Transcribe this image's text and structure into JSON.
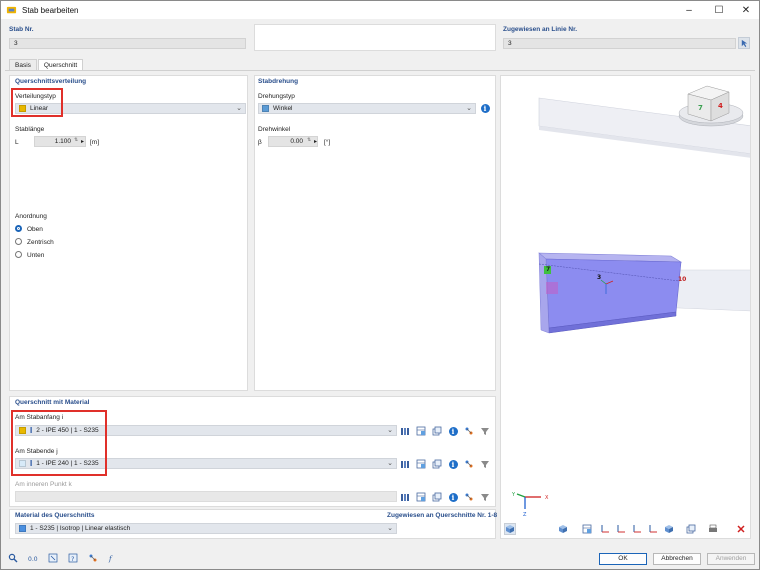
{
  "window": {
    "title": "Stab bearbeiten",
    "minimize": "–",
    "maximize": "☐",
    "close": "✕"
  },
  "header": {
    "member_no_label": "Stab Nr.",
    "member_no_value": "3",
    "line_label": "Zugewiesen an Linie Nr.",
    "line_value": "3"
  },
  "tabs": [
    {
      "label": "Basis"
    },
    {
      "label": "Querschnitt"
    }
  ],
  "distribution": {
    "section_title": "Querschnittsverteilung",
    "type_label": "Verteilungstyp",
    "type_value": "Linear",
    "type_color": "#e8b800",
    "length_label": "Stablänge",
    "length_symbol": "L",
    "length_value": "1.100",
    "length_unit": "[m]",
    "arrangement_label": "Anordnung",
    "options": [
      {
        "label": "Oben",
        "selected": true
      },
      {
        "label": "Zentrisch",
        "selected": false
      },
      {
        "label": "Unten",
        "selected": false
      }
    ]
  },
  "rotation": {
    "section_title": "Stabdrehung",
    "type_label": "Drehungstyp",
    "type_value": "Winkel",
    "type_color": "#5b9bd5",
    "angle_label": "Drehwinkel",
    "angle_symbol": "β",
    "angle_value": "0.00",
    "angle_unit": "[°]"
  },
  "cross_section": {
    "section_title": "Querschnitt mit Material",
    "start_label": "Am Stabanfang i",
    "start_value": "2 - IPE 450 | 1 - S235",
    "start_color": "#e8b800",
    "end_label": "Am Stabende j",
    "end_value": "1 - IPE 240 | 1 - S235",
    "end_color": "#d7eaf8",
    "inner_label": "Am inneren Punkt k"
  },
  "material": {
    "section_title": "Material des Querschnitts",
    "assigned_label": "Zugewiesen an Querschnitte Nr. 1-8",
    "value": "1 - S235 | Isotrop | Linear elastisch",
    "color": "#4a8fe0"
  },
  "viewport": {
    "member_label": "3",
    "node_label_start": "7",
    "node_label_end": "10",
    "cube_face_front": "7",
    "cube_face_side": "4",
    "axis_x": "X",
    "axis_y": "Y",
    "axis_z": "Z"
  },
  "buttons": {
    "ok": "OK",
    "cancel": "Abbrechen",
    "apply": "Anwenden"
  },
  "colors": {
    "accent": "#1a64b8",
    "highlight": "#e0302a",
    "section_header": "#2a4f8c",
    "beam": "#8c8cf0"
  }
}
